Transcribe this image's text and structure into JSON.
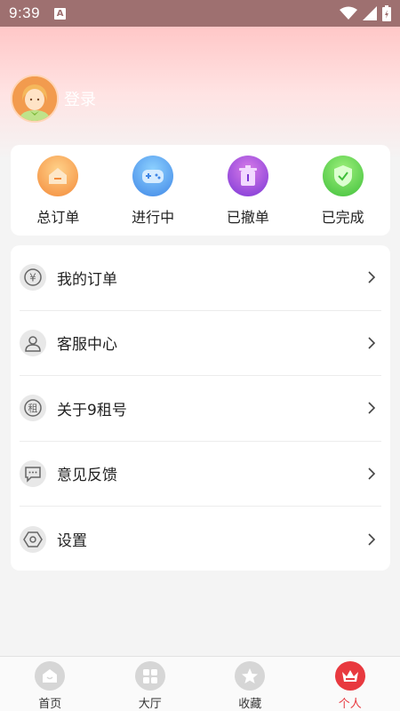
{
  "status_bar": {
    "time": "9:39",
    "badge": "A"
  },
  "profile": {
    "login_label": "登录"
  },
  "order_shortcuts": [
    {
      "label": "总订单",
      "icon": "total-orders-icon",
      "color": "#f7a85e"
    },
    {
      "label": "进行中",
      "icon": "in-progress-icon",
      "color": "#5aa8f0"
    },
    {
      "label": "已撤单",
      "icon": "cancelled-icon",
      "color": "#a94ad6"
    },
    {
      "label": "已完成",
      "icon": "completed-icon",
      "color": "#5ccf55"
    }
  ],
  "menu": [
    {
      "label": "我的订单",
      "icon": "yuan-icon",
      "icon_text": "¥"
    },
    {
      "label": "客服中心",
      "icon": "user-icon"
    },
    {
      "label": "关于9租号",
      "icon": "rent-icon",
      "icon_text": "租"
    },
    {
      "label": "意见反馈",
      "icon": "feedback-icon"
    },
    {
      "label": "设置",
      "icon": "settings-icon"
    }
  ],
  "tabbar": [
    {
      "label": "首页",
      "icon": "home-icon",
      "active": false
    },
    {
      "label": "大厅",
      "icon": "hall-icon",
      "active": false
    },
    {
      "label": "收藏",
      "icon": "star-icon",
      "active": false
    },
    {
      "label": "个人",
      "icon": "crown-icon",
      "active": true
    }
  ],
  "colors": {
    "accent": "#e8393f",
    "status_bar": "#9e7070",
    "header_pink": "#ffc7c7"
  }
}
